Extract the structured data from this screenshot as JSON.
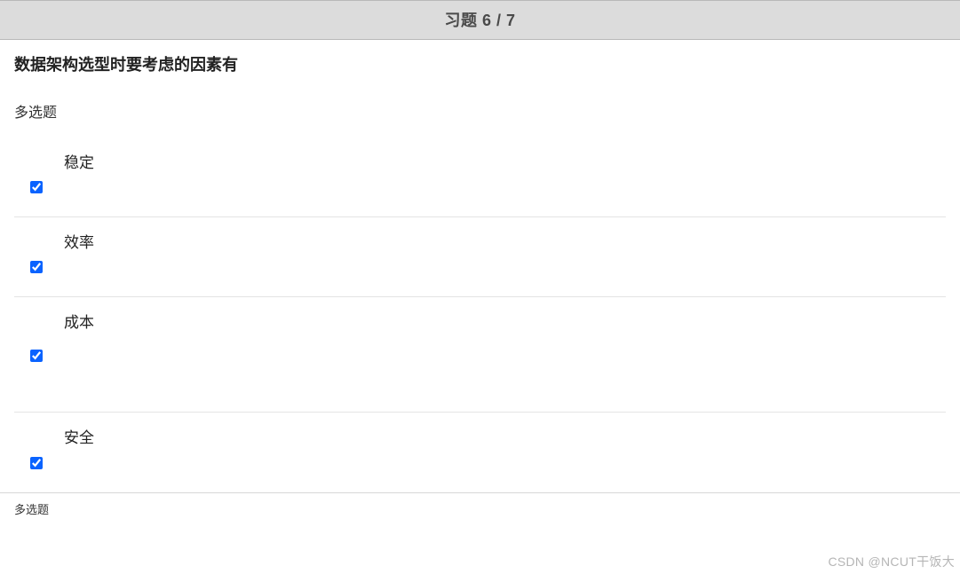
{
  "header": {
    "title": "习题 6 / 7"
  },
  "question": {
    "title": "数据架构选型时要考虑的因素有",
    "type": "多选题"
  },
  "options": [
    {
      "label": "稳定",
      "checked": true
    },
    {
      "label": "效率",
      "checked": true
    },
    {
      "label": "成本",
      "checked": true
    },
    {
      "label": "安全",
      "checked": true
    }
  ],
  "footer": {
    "type_label": "多选题"
  },
  "watermark": "CSDN @NCUT干饭大"
}
